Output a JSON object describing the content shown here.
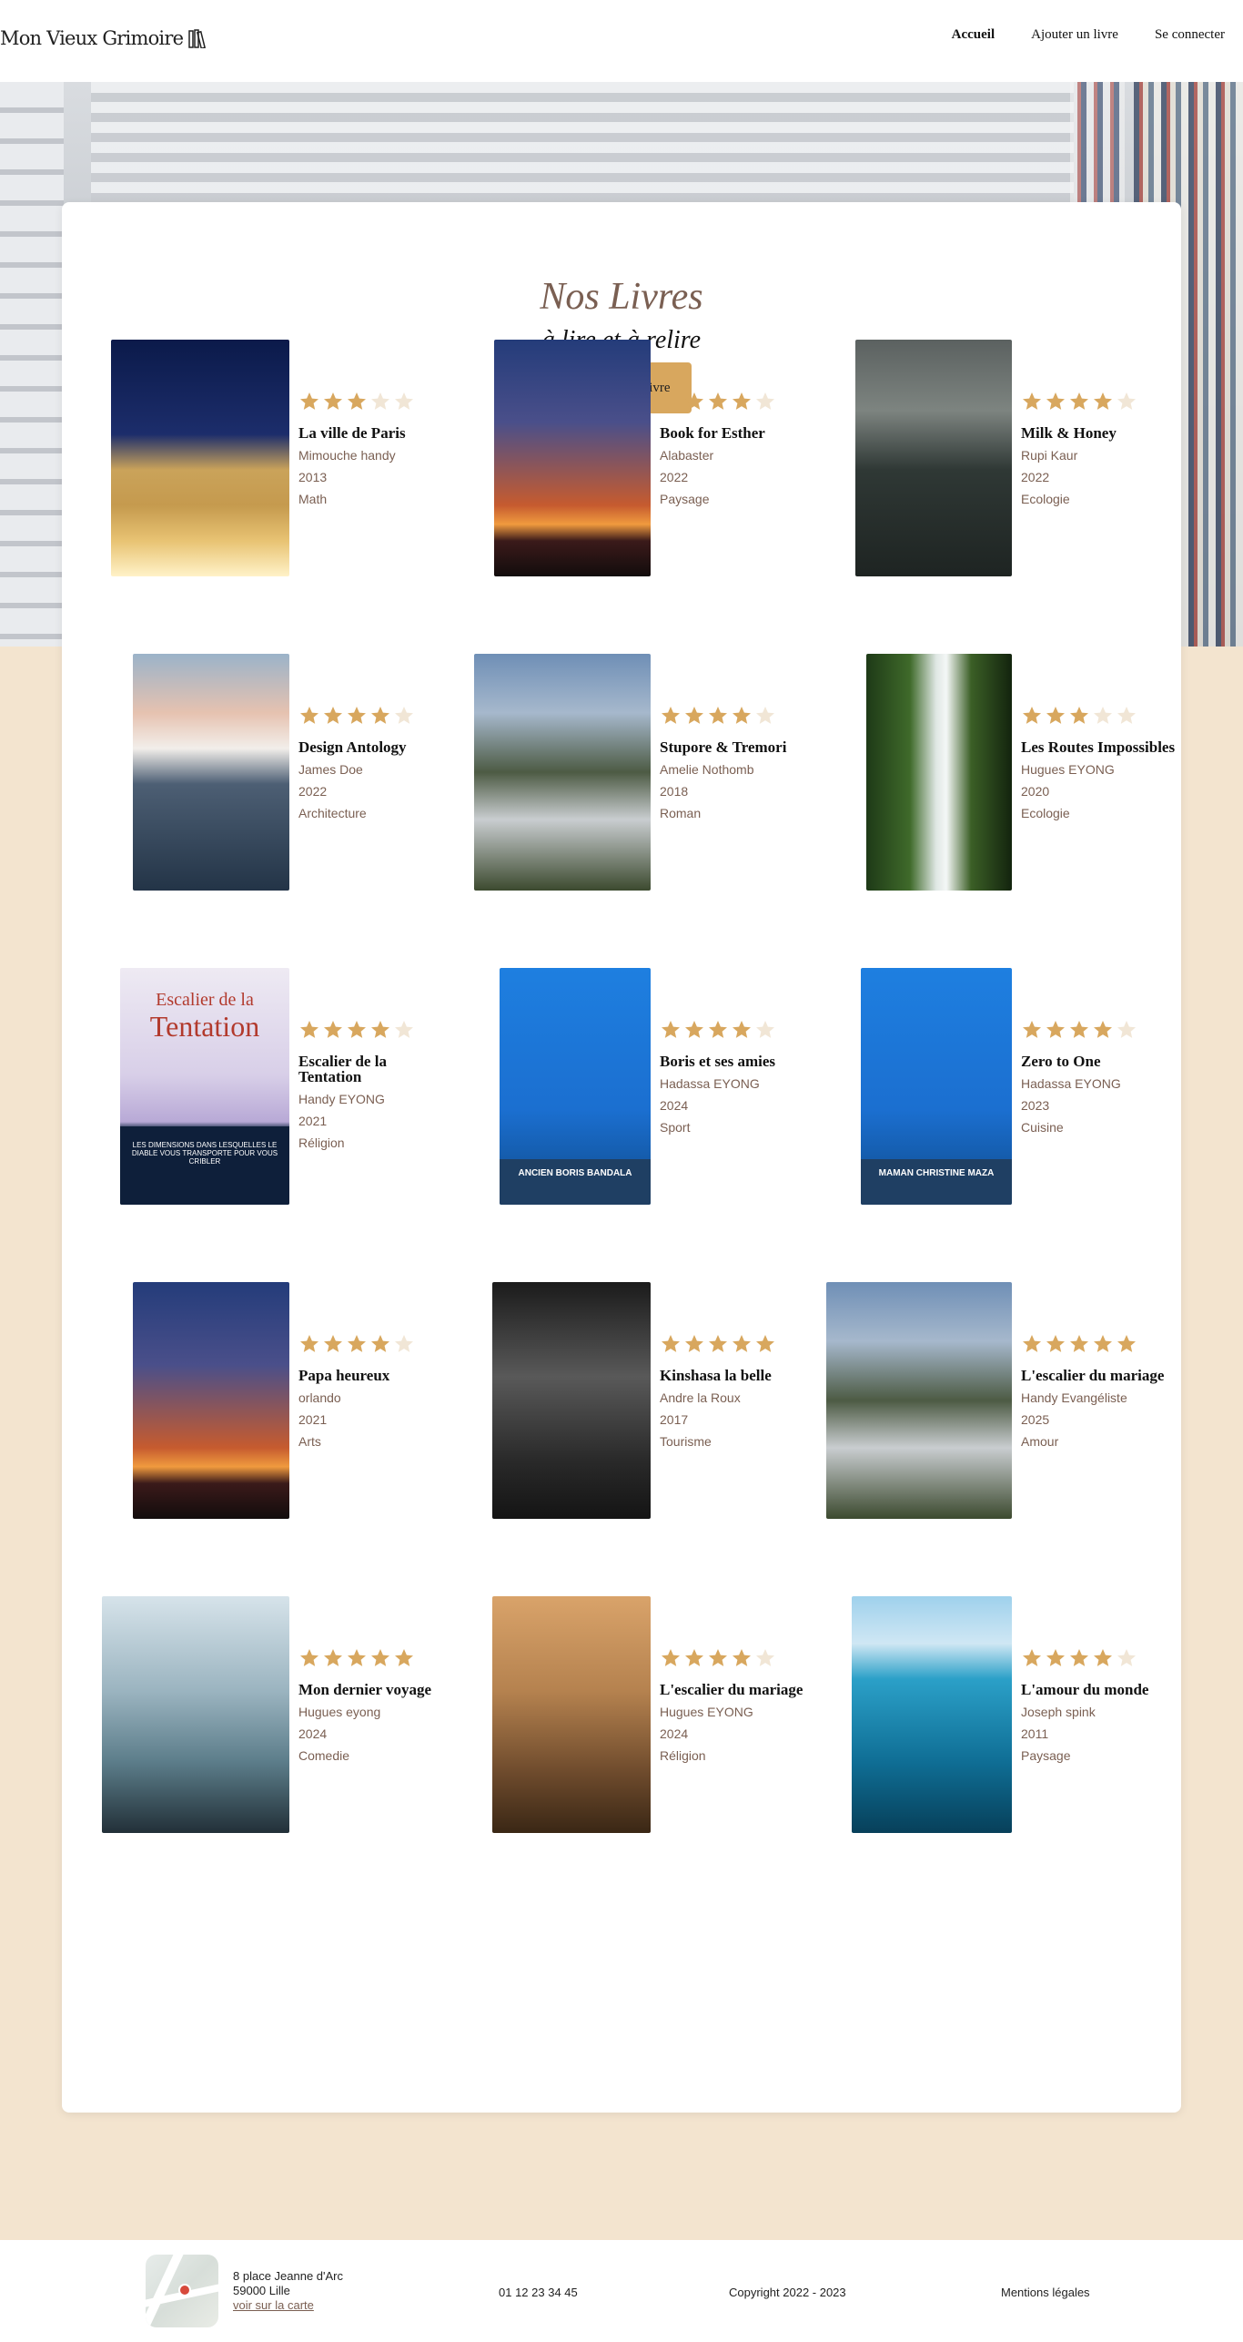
{
  "header": {
    "logo": "Mon Vieux Grimoire",
    "nav": [
      "Accueil",
      "Ajouter un livre",
      "Se connecter"
    ]
  },
  "page": {
    "title": "Nos Livres",
    "subtitle": "à lire et à relire",
    "add_button": "+ Ajouter un livre"
  },
  "colors": {
    "accent": "#d8a75e",
    "star_empty": "#f1e6d6",
    "muted_text": "#7a5f52"
  },
  "books": [
    {
      "title": "La ville de Paris",
      "author": "Mimouche handy",
      "year": "2013",
      "genre": "Math",
      "rating": 3,
      "cover": "arc"
    },
    {
      "title": "Book for Esther",
      "author": "Alabaster",
      "year": "2022",
      "genre": "Paysage",
      "rating": 4,
      "cover": "lamp"
    },
    {
      "title": "Milk & Honey",
      "author": "Rupi Kaur",
      "year": "2022",
      "genre": "Ecologie",
      "rating": 4,
      "cover": "road"
    },
    {
      "title": "Design Antology",
      "author": "James Doe",
      "year": "2022",
      "genre": "Architecture",
      "rating": 4,
      "cover": "boat"
    },
    {
      "title": "Stupore & Tremori",
      "author": "Amelie Nothomb",
      "year": "2018",
      "genre": "Roman",
      "rating": 4,
      "cover": "mountain"
    },
    {
      "title": "Les Routes Impossibles",
      "author": "Hugues EYONG",
      "year": "2020",
      "genre": "Ecologie",
      "rating": 3,
      "cover": "waterfall"
    },
    {
      "title": "Escalier de la Tentation",
      "author": "Handy EYONG",
      "year": "2021",
      "genre": "Réligion",
      "rating": 4,
      "cover": "escalier",
      "cover_title_1": "Escalier de la",
      "cover_title_2": "Tentation",
      "cover_tagline": "LES DIMENSIONS DANS LESQUELLES LE DIABLE VOUS TRANSPORTE POUR VOUS CRIBLER"
    },
    {
      "title": "Boris et ses amies",
      "author": "Hadassa EYONG",
      "year": "2024",
      "genre": "Sport",
      "rating": 4,
      "cover": "people",
      "cover_band": "ANCIEN BORIS BANDALA"
    },
    {
      "title": "Zero to One",
      "author": "Hadassa EYONG",
      "year": "2023",
      "genre": "Cuisine",
      "rating": 4,
      "cover": "people",
      "cover_band": "MAMAN CHRISTINE MAZA"
    },
    {
      "title": "Papa heureux",
      "author": "orlando",
      "year": "2021",
      "genre": "Arts",
      "rating": 4,
      "cover": "lamp"
    },
    {
      "title": "Kinshasa la belle",
      "author": "Andre la Roux",
      "year": "2017",
      "genre": "Tourisme",
      "rating": 5,
      "cover": "stage"
    },
    {
      "title": "L'escalier du mariage",
      "author": "Handy Evangéliste",
      "year": "2025",
      "genre": "Amour",
      "rating": 5,
      "cover": "mountain"
    },
    {
      "title": "Mon dernier voyage",
      "author": "Hugues eyong",
      "year": "2024",
      "genre": "Comedie",
      "rating": 5,
      "cover": "waterfall2"
    },
    {
      "title": "L'escalier du mariage",
      "author": "Hugues EYONG",
      "year": "2024",
      "genre": "Réligion",
      "rating": 4,
      "cover": "wedding"
    },
    {
      "title": "L'amour du monde",
      "author": "Joseph spink",
      "year": "2011",
      "genre": "Paysage",
      "rating": 4,
      "cover": "ocean"
    }
  ],
  "footer": {
    "address_line1": "8 place Jeanne d'Arc",
    "address_line2": "59000 Lille",
    "map_link": "voir sur la carte",
    "phone": "01 12 23 34 45",
    "copyright": "Copyright 2022 - 2023",
    "legal": "Mentions légales"
  }
}
